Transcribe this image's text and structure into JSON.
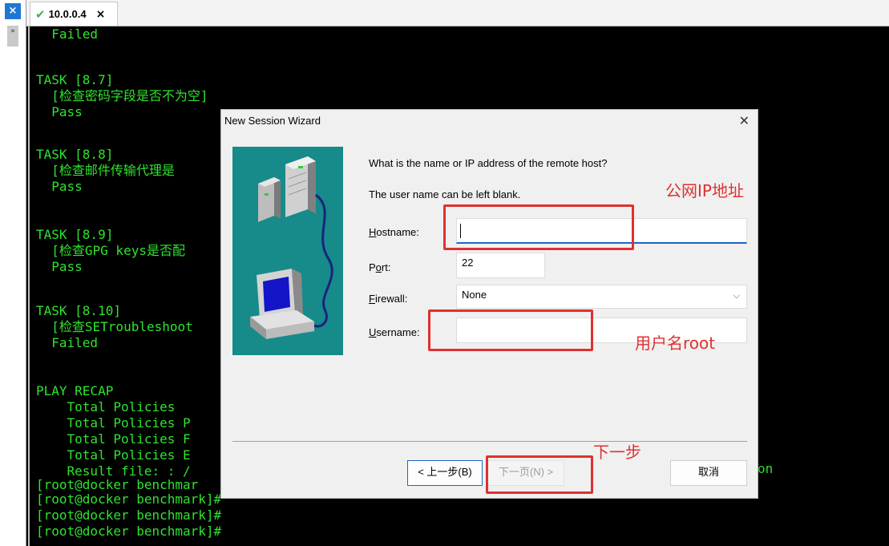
{
  "tab": {
    "title": "10.0.0.4",
    "close_glyph": "×"
  },
  "sidebar": {
    "close_glyph": "×",
    "collapse_glyph": "»"
  },
  "terminal": {
    "lines": [
      "  Failed",
      "",
      "",
      "TASK [8.7]",
      "  [检查密码字段是否不为空]",
      "  Pass",
      "",
      "",
      "TASK [8.8]",
      "  [检查邮件传输代理是",
      "  Pass",
      "",
      "",
      "TASK [8.9]",
      "  [检查GPG keys是否配",
      "  Pass",
      "",
      "",
      "TASK [8.10]",
      "  [检查SETroubleshoot",
      "  Failed",
      "",
      "",
      "PLAY RECAP",
      "    Total Policies",
      "    Total Policies P",
      "    Total Policies F",
      "    Total Policies E",
      "    Result file: : /",
      "[root@docker benchmar",
      "[root@docker benchmark]#",
      "[root@docker benchmark]#",
      "[root@docker benchmark]#"
    ],
    "right_fragment": "on"
  },
  "dialog": {
    "title": "New Session Wizard",
    "close_glyph": "✕",
    "question": "What is the name or IP address of the remote host?",
    "note": "The user name can be left blank.",
    "fields": {
      "hostname": {
        "label_u": "H",
        "label_rest": "ostname:",
        "value": ""
      },
      "port": {
        "label_pre": "P",
        "label_u": "o",
        "label_rest": "rt:",
        "value": "22"
      },
      "firewall": {
        "label_u": "F",
        "label_rest": "irewall:",
        "value": "None"
      },
      "username": {
        "label_u": "U",
        "label_rest": "sername:",
        "value": ""
      }
    },
    "buttons": {
      "back": "< 上一步(B)",
      "next": "下一页(N) >",
      "cancel": "取消"
    }
  },
  "annotations": {
    "hostname_note": "公网IP地址",
    "username_note": "用户名root",
    "next_note": "下一步"
  },
  "colors": {
    "terminal_bg": "#000000",
    "terminal_fg": "#2fe32f",
    "annotation": "#e03030",
    "illustration_bg": "#178a8a",
    "accent": "#1c66c8"
  }
}
